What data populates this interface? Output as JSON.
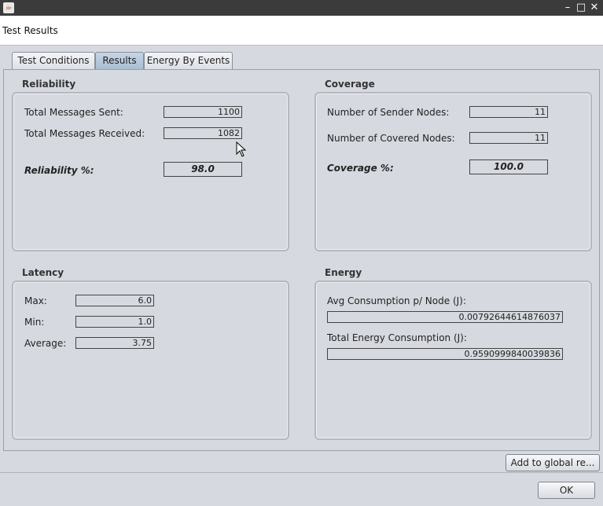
{
  "window": {
    "title": "Test Results"
  },
  "tabs": [
    {
      "label": "Test Conditions",
      "selected": false
    },
    {
      "label": "Results",
      "selected": true
    },
    {
      "label": "Energy By Events",
      "selected": false
    }
  ],
  "reliability": {
    "title": "Reliability",
    "sent_label": "Total Messages Sent:",
    "sent_value": "1100",
    "received_label": "Total Messages Received:",
    "received_value": "1082",
    "pct_label": "Reliability %:",
    "pct_value": "98.0"
  },
  "coverage": {
    "title": "Coverage",
    "sender_label": "Number of Sender Nodes:",
    "sender_value": "11",
    "covered_label": "Number of Covered Nodes:",
    "covered_value": "11",
    "pct_label": "Coverage %:",
    "pct_value": "100.0"
  },
  "latency": {
    "title": "Latency",
    "max_label": "Max:",
    "max_value": "6.0",
    "min_label": "Min:",
    "min_value": "1.0",
    "avg_label": "Average:",
    "avg_value": "3.75"
  },
  "energy": {
    "title": "Energy",
    "avg_label": "Avg Consumption p/ Node (J):",
    "avg_value": "0.00792644614876037",
    "total_label": "Total Energy Consumption (J):",
    "total_value": "0.9590999840039836"
  },
  "buttons": {
    "add_global": "Add to global re...",
    "ok": "OK"
  },
  "icons": {
    "app": "java-cup-icon",
    "minimize": "minimize-icon",
    "maximize": "maximize-icon",
    "close": "close-icon"
  }
}
